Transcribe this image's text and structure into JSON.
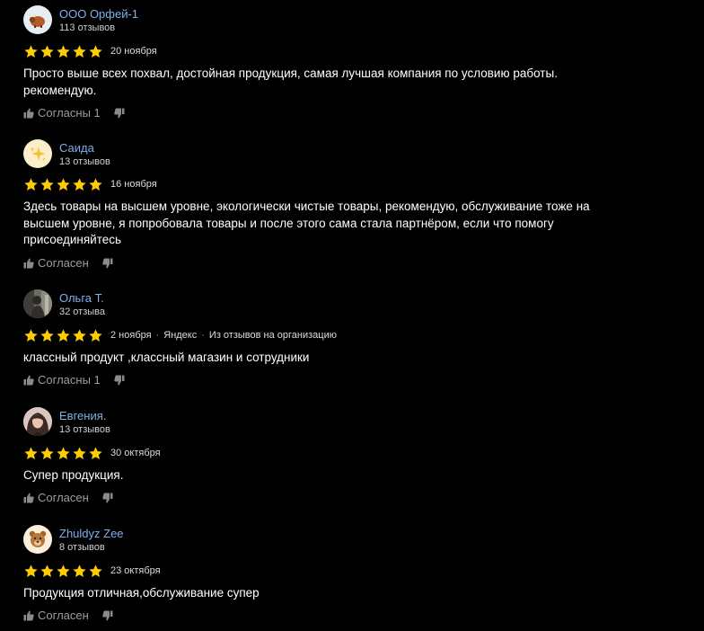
{
  "reviews": [
    {
      "author": "ООО Орфей-1",
      "count": "113 отзывов",
      "rating": 5,
      "date": "20 ноября",
      "source": "",
      "extra": "",
      "text": "Просто выше всех похвал, достойная продукция, самая лучшая компания по условию работы. рекомендую.",
      "agree_label": "Согласны 1",
      "avatar_icon": "bull-emoji-icon"
    },
    {
      "author": "Саида",
      "count": "13 отзывов",
      "rating": 5,
      "date": "16 ноября",
      "source": "",
      "extra": "",
      "text": "Здесь товары на высшем уровне, экологически чистые товары, рекомендую, обслуживание тоже на высшем уровне, я попробовала товары и после этого сама стала партнёром, если что помогу присоединяйтесь",
      "agree_label": "Согласен",
      "avatar_icon": "sparkles-emoji-icon"
    },
    {
      "author": "Ольга Т.",
      "count": "32 отзыва",
      "rating": 5,
      "date": "2 ноября",
      "source": "Яндекс",
      "extra": "Из отзывов на организацию",
      "text": "классный продукт ,классный магазин и сотрудники",
      "agree_label": "Согласны 1",
      "avatar_icon": "photo-avatar"
    },
    {
      "author": "Евгения.",
      "count": "13 отзывов",
      "rating": 5,
      "date": "30 октября",
      "source": "",
      "extra": "",
      "text": "Супер продукция.",
      "agree_label": "Согласен",
      "avatar_icon": "photo-avatar"
    },
    {
      "author": "Zhuldyz Zee",
      "count": "8 отзывов",
      "rating": 5,
      "date": "23 октября",
      "source": "",
      "extra": "",
      "text": "Продукция отличная,обслуживание супер",
      "agree_label": "Согласен",
      "avatar_icon": "bear-emoji-icon"
    }
  ],
  "colors": {
    "background": "#000000",
    "author_link": "#7fb0e8",
    "star": "#ffcc00",
    "muted": "#9d9d9d"
  }
}
